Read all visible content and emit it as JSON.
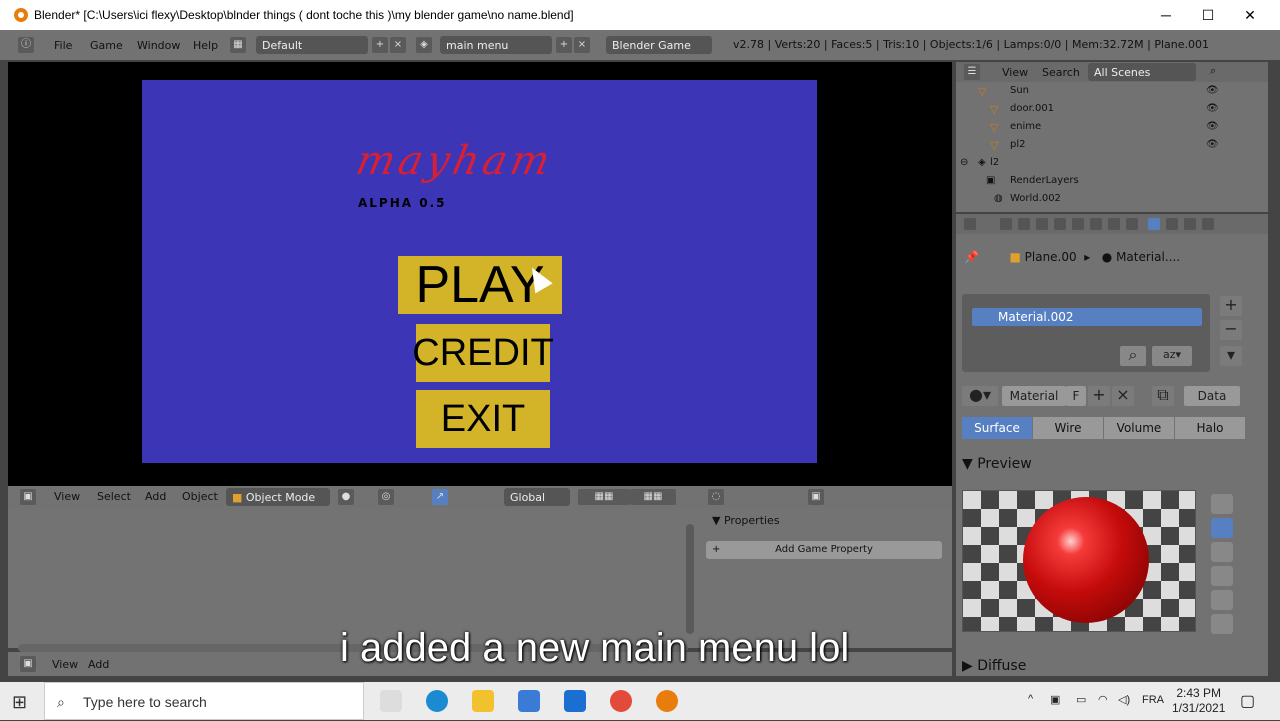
{
  "window": {
    "title": "Blender* [C:\\Users\\ici flexy\\Desktop\\blnder things ( dont toche this )\\my blender game\\no name.blend]",
    "minimize": "─",
    "maximize": "☐",
    "close": "✕"
  },
  "menubar": {
    "items": [
      "File",
      "Game",
      "Window",
      "Help"
    ],
    "layout": "Default",
    "scene": "main menu",
    "engine": "Blender Game",
    "stats": "v2.78 | Verts:20 | Faces:5 | Tris:10 | Objects:1/6 | Lamps:0/0 | Mem:32.72M | Plane.001"
  },
  "game": {
    "title": "mayham",
    "version": "ALPHA 0.5",
    "buttons": {
      "play": "PLAY",
      "credit": "CREDIT",
      "exit": "EXIT"
    }
  },
  "viewport_header": {
    "view": "View",
    "select": "Select",
    "add": "Add",
    "object": "Object",
    "mode": "Object Mode",
    "orientation": "Global"
  },
  "logic": {
    "properties_title": "Properties",
    "add_property": "Add Game Property"
  },
  "bottom": {
    "view": "View",
    "add": "Add"
  },
  "subtitle": "i added a new main menu lol",
  "outliner": {
    "view": "View",
    "search": "Search",
    "filter": "All Scenes",
    "rows": [
      "Sun",
      "door.001",
      "enime",
      "pl2",
      "l2",
      "RenderLayers",
      "World.002"
    ]
  },
  "properties": {
    "object": "Plane.00",
    "material": "Material....",
    "slot": "Material.002",
    "mat_name": "Material",
    "mat_f": "F",
    "data": "Data",
    "tabs": [
      "Surface",
      "Wire",
      "Volume",
      "Halo"
    ],
    "preview": "Preview",
    "diffuse": "Diffuse"
  },
  "taskbar": {
    "search": "Type here to search",
    "lang": "FRA",
    "time": "2:43 PM",
    "date": "1/31/2021"
  },
  "colors": {
    "game_bg": "#3c35b6",
    "button": "#d3b428",
    "title": "#d81f34",
    "accent": "#5680c2"
  }
}
